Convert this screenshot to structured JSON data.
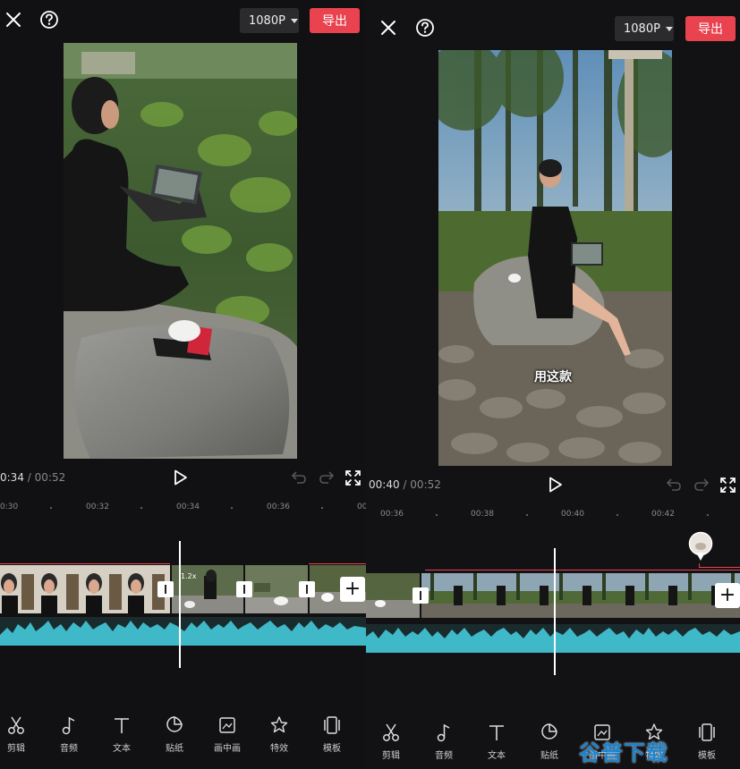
{
  "left": {
    "resolution": "1080P",
    "export_label": "导出",
    "current_time": "0:34",
    "separator": "/",
    "total_time": "00:52",
    "ruler_ticks": [
      "0:30",
      "00:32",
      "00:34",
      "00:36",
      "00"
    ],
    "speed_badge": "1.2x",
    "tools": [
      {
        "label": "剪辑",
        "icon": "scissors-icon"
      },
      {
        "label": "音频",
        "icon": "music-note-icon"
      },
      {
        "label": "文本",
        "icon": "text-icon"
      },
      {
        "label": "贴纸",
        "icon": "sticker-icon"
      },
      {
        "label": "画中画",
        "icon": "picture-in-picture-icon"
      },
      {
        "label": "特效",
        "icon": "effects-star-icon"
      },
      {
        "label": "模板",
        "icon": "template-icon"
      }
    ]
  },
  "right": {
    "resolution": "1080P",
    "export_label": "导出",
    "current_time": "00:40",
    "separator": "/",
    "total_time": "00:52",
    "ruler_ticks": [
      "00:36",
      "00:38",
      "00:40",
      "00:42"
    ],
    "subtitle": "用这款",
    "tools": [
      {
        "label": "剪辑",
        "icon": "scissors-icon"
      },
      {
        "label": "音频",
        "icon": "music-note-icon"
      },
      {
        "label": "文本",
        "icon": "text-icon"
      },
      {
        "label": "贴纸",
        "icon": "sticker-icon"
      },
      {
        "label": "画中画",
        "icon": "picture-in-picture-icon"
      },
      {
        "label": "特效",
        "icon": "effects-star-icon"
      },
      {
        "label": "模板",
        "icon": "template-icon"
      }
    ]
  },
  "watermark": "谷普下载",
  "colors": {
    "accent": "#e8434f",
    "waveform": "#3fb8c8",
    "background": "#111113",
    "clip_marker": "#e8434f"
  }
}
